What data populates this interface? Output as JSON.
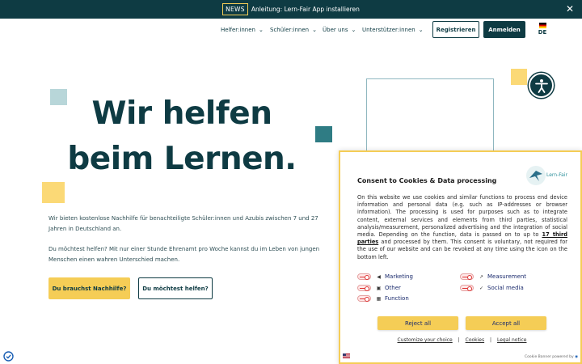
{
  "newsbar": {
    "badge": "NEWS",
    "text": "Anleitung: Lern-Fair App installieren",
    "close": "✕"
  },
  "nav": {
    "items": [
      {
        "label": "Helfer:innen"
      },
      {
        "label": "Schüler:innen"
      },
      {
        "label": "Über uns"
      },
      {
        "label": "Unterstützer:innen"
      }
    ],
    "register": "Registrieren",
    "login": "Anmelden",
    "lang": "DE"
  },
  "hero": {
    "title_line1": "Wir helfen",
    "title_line2": "beim Lernen.",
    "text1": "Wir bieten kostenlose Nachhilfe für benachteiligte Schüler:innen und Azubis zwischen 7 und 27 Jahren in Deutschland an.",
    "text2": "Du möchtest helfen? Mit nur einer Stunde Ehrenamt pro Woche kannst du im Leben von jungen Menschen einen wahren Unterschied machen.",
    "btn_primary": "Du brauchst Nachhilfe?",
    "btn_secondary": "Du möchtest helfen?"
  },
  "cookie": {
    "title": "Consent to Cookies & Data processing",
    "logo_text": "Lern-Fair",
    "body_before": "On this website we use cookies and similar functions to process end device information and personal data (e.g. such as IP-addresses or browser information). The processing is used for purposes such as to integrate content, external services and elements from third parties, statistical analysis/measurement, personalized advertising and the integration of social media. Depending on the function, data is passed on to up to ",
    "body_link": "17 third parties",
    "body_after": " and processed by them. This consent is voluntary, not required for the use of our website and can be revoked at any time using the icon on the bottom left.",
    "toggles": {
      "marketing": "Marketing",
      "measurement": "Measurement",
      "other": "Other",
      "social": "Social media",
      "function": "Function"
    },
    "reject": "Reject all",
    "accept": "Accept all",
    "links": {
      "customize": "Customize your choice",
      "cookies": "Cookies",
      "legal": "Legal notice",
      "sep": "|"
    },
    "powered": "Cookie Banner powered by"
  },
  "colors": {
    "primary": "#0e3b43",
    "accent": "#f5cd56",
    "teal_square": "#2f7c84",
    "light_square": "#b8d6d9"
  }
}
